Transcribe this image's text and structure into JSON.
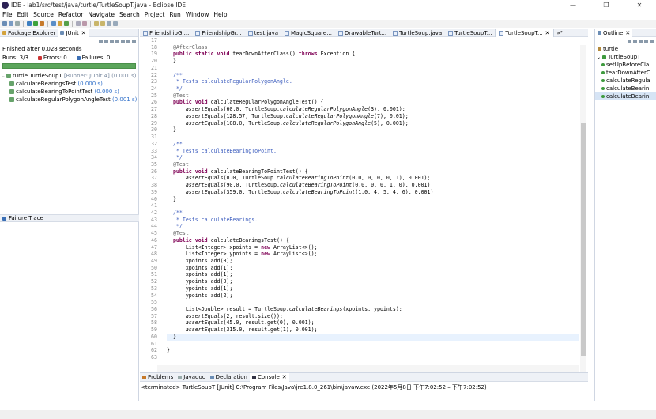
{
  "window": {
    "title": "IDE - lab1/src/test/java/turtle/TurtleSoupT.java - Eclipse IDE",
    "minimize": "—",
    "restore": "❐",
    "close": "✕"
  },
  "menu": [
    "File",
    "Edit",
    "Source",
    "Refactor",
    "Navigate",
    "Search",
    "Project",
    "Run",
    "Window",
    "Help"
  ],
  "left_panel": {
    "tab_package": "Package Explorer",
    "tab_junit": "JUnit",
    "finished": "Finished after 0.028 seconds",
    "runs": "Runs: 3/3",
    "errors": "Errors: 0",
    "failures": "Failures: 0",
    "tree": {
      "root": "turtle.TurtleSoupT",
      "root_meta": "[Runner: JUnit 4] (0.001 s)",
      "tests": [
        {
          "name": "calculateBearingsTest",
          "time": "(0.000 s)"
        },
        {
          "name": "calculateBearingToPointTest",
          "time": "(0.000 s)"
        },
        {
          "name": "calculateRegularPolygonAngleTest",
          "time": "(0.001 s)"
        }
      ]
    },
    "failure_trace": "Failure Trace"
  },
  "editor": {
    "tabs": [
      "FriendshipGr...",
      "FriendshipGr...",
      "test.java",
      "MagicSquare...",
      "DrawableTurt...",
      "TurtleSoup.java",
      "TurtleSoupT...",
      "TurtleSoupT..."
    ],
    "overflow": "»⁷",
    "line_numbers": [
      "17",
      "18",
      "19",
      "20",
      "21",
      "22",
      "23",
      "24",
      "25",
      "26",
      "27",
      "28",
      "29",
      "30",
      "31",
      "32",
      "33",
      "34",
      "35",
      "36",
      "37",
      "38",
      "39",
      "40",
      "41",
      "42",
      "43",
      "44",
      "45",
      "46",
      "47",
      "48",
      "49",
      "50",
      "51",
      "52",
      "53",
      "54",
      "55",
      "56",
      "57",
      "58",
      "59",
      "60",
      "61",
      "62",
      "63"
    ]
  },
  "outline": {
    "tab": "Outline",
    "items": [
      {
        "label": "turtle"
      },
      {
        "label": "TurtleSoupT"
      },
      {
        "label": "setUpBeforeCla"
      },
      {
        "label": "tearDownAfterC"
      },
      {
        "label": "calculateRegula"
      },
      {
        "label": "calculateBearin"
      },
      {
        "label": "calculateBearin"
      }
    ]
  },
  "bottom": {
    "tabs": [
      "Problems",
      "Javadoc",
      "Declaration",
      "Console"
    ],
    "console_line": "<terminated> TurtleSoupT [JUnit] C:\\Program Files\\Java\\jre1.8.0_261\\bin\\javaw.exe  (2022年5月8日 下午7:02:52 – 下午7:02:52)"
  },
  "colors": {
    "progress": "#5ba55b",
    "keyword": "#7f0055",
    "comment": "#3f5fbf",
    "annotation": "#646464"
  }
}
